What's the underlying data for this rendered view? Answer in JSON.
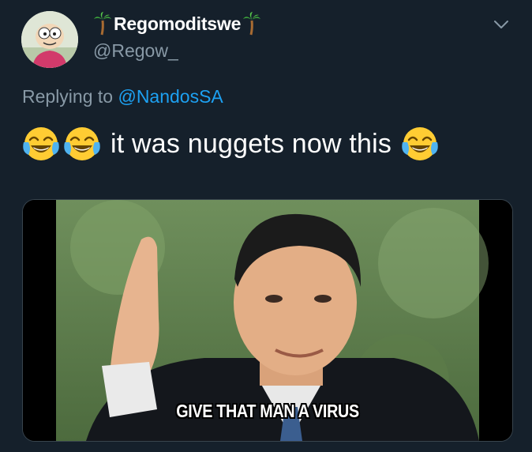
{
  "author": {
    "display_name": "Regomoditswe",
    "handle": "@Regow_",
    "avatar_icon": "cartoon-character-avatar",
    "name_decoration_icon": "palm-tree-icon"
  },
  "reply": {
    "prefix": "Replying to",
    "mention": "@NandosSA"
  },
  "tweet": {
    "text": "it was nuggets now this",
    "emoji_icon": "face-with-tears-of-joy-icon"
  },
  "media": {
    "caption": "GIVE THAT MAN A VIRUS"
  },
  "colors": {
    "background": "#15202b",
    "secondary_text": "#8899a6",
    "link": "#1da1f2",
    "border": "#38444d"
  }
}
